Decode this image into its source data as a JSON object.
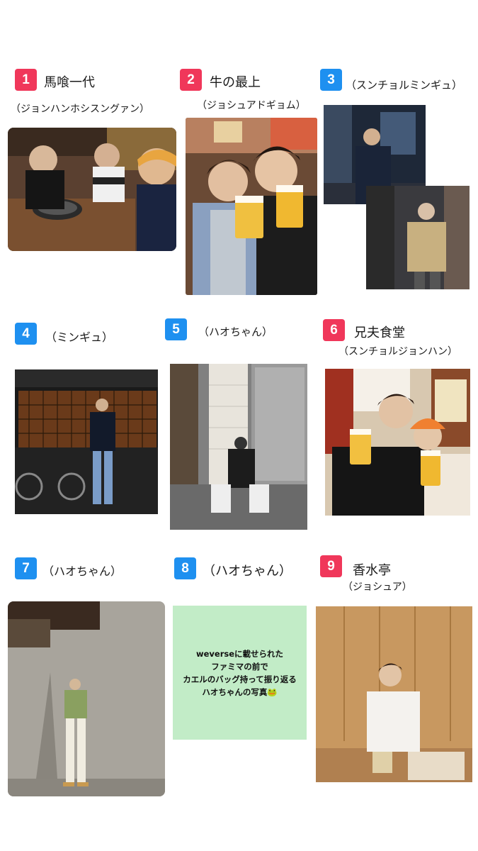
{
  "items": [
    {
      "number": "1",
      "title": "馬喰一代",
      "subtitle": "（ジョンハンホシスングァン）",
      "photo": "three-people-at-yakiniku-restaurant"
    },
    {
      "number": "2",
      "title": "牛の最上",
      "subtitle": "（ジョシュアドギョム）",
      "photo": "two-people-holding-beer-mugs"
    },
    {
      "number": "3",
      "title": "",
      "subtitle": "（スンチョルミンギュ）",
      "photo": "two-photos-night-street"
    },
    {
      "number": "4",
      "title": "",
      "subtitle": "（ミンギュ）",
      "photo": "person-standing-at-night"
    },
    {
      "number": "5",
      "title": "",
      "subtitle": "（ハオちゃん）",
      "photo": "person-sitting-by-doorway"
    },
    {
      "number": "6",
      "title": "兄夫食堂",
      "subtitle": "（スンチョルジョンハン）",
      "photo": "two-people-toasting-beer"
    },
    {
      "number": "7",
      "title": "",
      "subtitle": "（ハオちゃん）",
      "photo": "person-standing-by-wall"
    },
    {
      "number": "8",
      "title": "",
      "subtitle": "（ハオちゃん）",
      "photo": ""
    },
    {
      "number": "9",
      "title": "香水亭",
      "subtitle": "（ジョシュア）",
      "photo": "person-seated-at-dining-table"
    }
  ],
  "note_card": {
    "lines": [
      "weverseに載せられた",
      "ファミマの前で",
      "カエルのバッグ持って振り返る",
      "ハオちゃんの写真"
    ],
    "emoji": "🐸"
  },
  "colors": {
    "badge_red": "#f0375a",
    "badge_blue": "#1e90f0",
    "note_bg": "#c2ecc7"
  }
}
